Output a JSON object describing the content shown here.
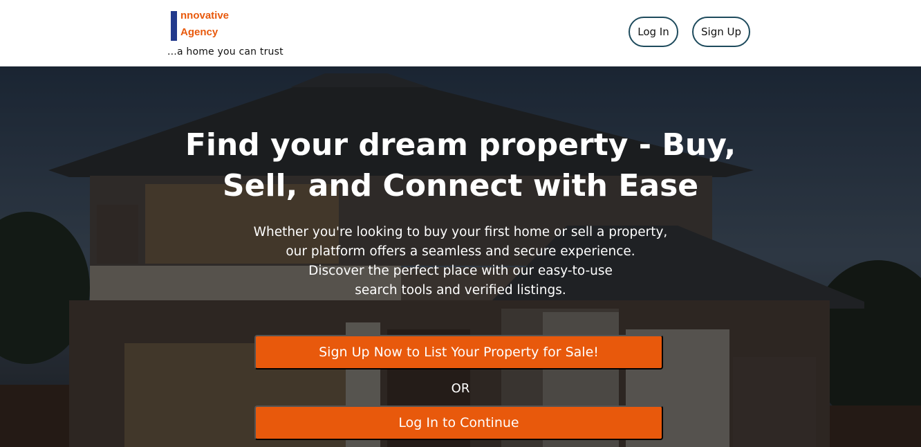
{
  "header": {
    "logo_line1": "nnovative",
    "logo_line2": "Agency",
    "tagline": "...a home you can trust",
    "login_label": "Log In",
    "signup_label": "Sign Up"
  },
  "hero": {
    "headline": "Find your dream property - Buy, Sell, and Connect with Ease",
    "subtext_lines": [
      "Whether you're looking to buy your first home or sell a property,",
      "our platform offers a seamless and secure experience.",
      "Discover the perfect place with our easy-to-use",
      "search tools and verified listings."
    ],
    "cta_primary": "Sign Up Now to List Your Property for Sale!",
    "or_text": "OR",
    "cta_secondary": "Log In to Continue",
    "background_image": "house-at-dusk-photo"
  },
  "colors": {
    "brand_orange": "#e8590c",
    "logo_bar": "#223a8c",
    "nav_border": "#1d4a5c"
  }
}
